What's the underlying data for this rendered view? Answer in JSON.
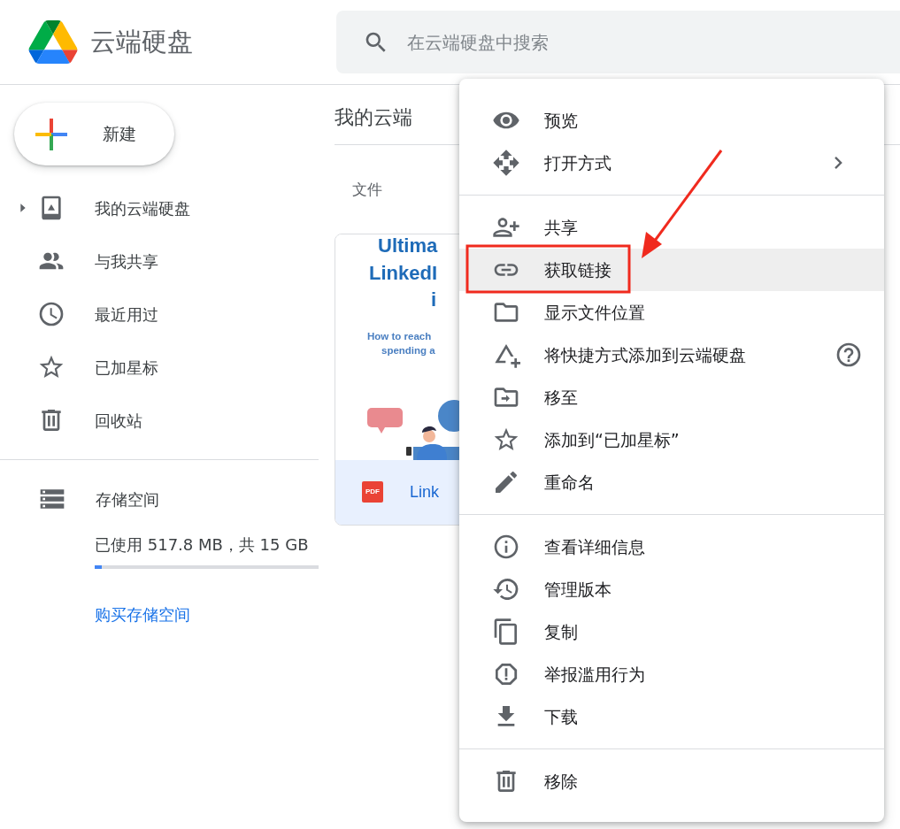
{
  "app": {
    "title": "云端硬盘"
  },
  "search": {
    "placeholder": "在云端硬盘中搜索"
  },
  "new_button": {
    "label": "新建"
  },
  "sidebar": {
    "items": [
      {
        "label": "我的云端硬盘",
        "expandable": true,
        "selected": false
      },
      {
        "label": "与我共享",
        "expandable": false,
        "selected": false
      },
      {
        "label": "最近用过",
        "expandable": false,
        "selected": false
      },
      {
        "label": "已加星标",
        "expandable": false,
        "selected": false
      },
      {
        "label": "回收站",
        "expandable": false,
        "selected": false
      }
    ]
  },
  "storage": {
    "label": "存储空间",
    "usage": "已使用 517.8 MB，共 15 GB",
    "level": 0.03,
    "buy_link": "购买存储空间"
  },
  "main": {
    "title": "我的云端",
    "section": "文件",
    "file": {
      "type_badge": "PDF",
      "name": "Link",
      "thumbnail_lines": [
        "Ultima",
        "LinkedI",
        "i",
        "How to reach",
        "spending a"
      ]
    }
  },
  "context_menu": {
    "groups": [
      [
        {
          "label": "预览",
          "highlighted": false,
          "submenu": false,
          "help": false
        },
        {
          "label": "打开方式",
          "highlighted": false,
          "submenu": true,
          "help": false
        }
      ],
      [
        {
          "label": "共享",
          "highlighted": false,
          "submenu": false,
          "help": false
        },
        {
          "label": "获取链接",
          "highlighted": true,
          "submenu": false,
          "help": false
        },
        {
          "label": "显示文件位置",
          "highlighted": false,
          "submenu": false,
          "help": false
        },
        {
          "label": "将快捷方式添加到云端硬盘",
          "highlighted": false,
          "submenu": false,
          "help": true
        },
        {
          "label": "移至",
          "highlighted": false,
          "submenu": false,
          "help": false
        },
        {
          "label": "添加到“已加星标”",
          "highlighted": false,
          "submenu": false,
          "help": false
        },
        {
          "label": "重命名",
          "highlighted": false,
          "submenu": false,
          "help": false
        }
      ],
      [
        {
          "label": "查看详细信息",
          "highlighted": false,
          "submenu": false,
          "help": false
        },
        {
          "label": "管理版本",
          "highlighted": false,
          "submenu": false,
          "help": false
        },
        {
          "label": "复制",
          "highlighted": false,
          "submenu": false,
          "help": false
        },
        {
          "label": "举报滥用行为",
          "highlighted": false,
          "submenu": false,
          "help": false
        },
        {
          "label": "下载",
          "highlighted": false,
          "submenu": false,
          "help": false
        }
      ],
      [
        {
          "label": "移除",
          "highlighted": false,
          "submenu": false,
          "help": false
        }
      ]
    ]
  }
}
